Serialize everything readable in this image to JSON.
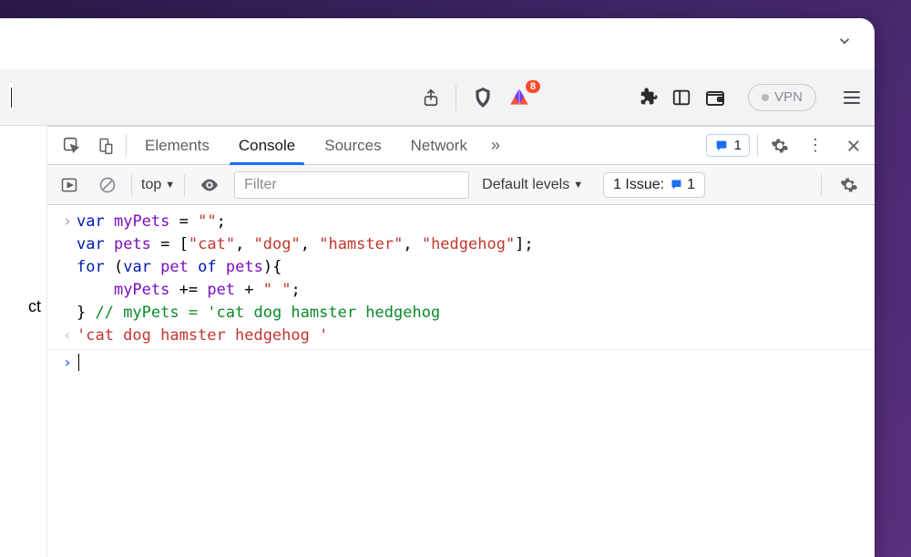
{
  "titlebar": {
    "chevron_name": "chevron-down-icon"
  },
  "toolbar": {
    "brave_badge": "8",
    "vpn_label": "VPN"
  },
  "page_fragment": "ct",
  "devtools": {
    "tabs": {
      "elements": "Elements",
      "console": "Console",
      "sources": "Sources",
      "network": "Network",
      "more": "»"
    },
    "messages_count": "1",
    "filters": {
      "context": "top",
      "filter_placeholder": "Filter",
      "levels": "Default levels",
      "issue_label": "1 Issue:",
      "issue_count": "1"
    },
    "console": {
      "input_lines": [
        [
          {
            "t": "kw",
            "v": "var"
          },
          {
            "t": "pn",
            "v": " "
          },
          {
            "t": "va",
            "v": "myPets"
          },
          {
            "t": "pn",
            "v": " = "
          },
          {
            "t": "str",
            "v": "\"\""
          },
          {
            "t": "pn",
            "v": ";"
          }
        ],
        [
          {
            "t": "kw",
            "v": "var"
          },
          {
            "t": "pn",
            "v": " "
          },
          {
            "t": "va",
            "v": "pets"
          },
          {
            "t": "pn",
            "v": " = ["
          },
          {
            "t": "str",
            "v": "\"cat\""
          },
          {
            "t": "pn",
            "v": ", "
          },
          {
            "t": "str",
            "v": "\"dog\""
          },
          {
            "t": "pn",
            "v": ", "
          },
          {
            "t": "str",
            "v": "\"hamster\""
          },
          {
            "t": "pn",
            "v": ", "
          },
          {
            "t": "str",
            "v": "\"hedgehog\""
          },
          {
            "t": "pn",
            "v": "];"
          }
        ],
        [
          {
            "t": "kw",
            "v": "for"
          },
          {
            "t": "pn",
            "v": " ("
          },
          {
            "t": "kw",
            "v": "var"
          },
          {
            "t": "pn",
            "v": " "
          },
          {
            "t": "va",
            "v": "pet"
          },
          {
            "t": "pn",
            "v": " "
          },
          {
            "t": "kw",
            "v": "of"
          },
          {
            "t": "pn",
            "v": " "
          },
          {
            "t": "va",
            "v": "pets"
          },
          {
            "t": "pn",
            "v": "){"
          }
        ],
        [
          {
            "t": "pn",
            "v": "    "
          },
          {
            "t": "va",
            "v": "myPets"
          },
          {
            "t": "pn",
            "v": " += "
          },
          {
            "t": "va",
            "v": "pet"
          },
          {
            "t": "pn",
            "v": " + "
          },
          {
            "t": "str",
            "v": "\" \""
          },
          {
            "t": "pn",
            "v": ";"
          }
        ],
        [
          {
            "t": "pn",
            "v": "} "
          },
          {
            "t": "cm",
            "v": "// myPets = 'cat dog hamster hedgehog"
          }
        ]
      ],
      "output": "'cat dog hamster hedgehog '"
    }
  }
}
